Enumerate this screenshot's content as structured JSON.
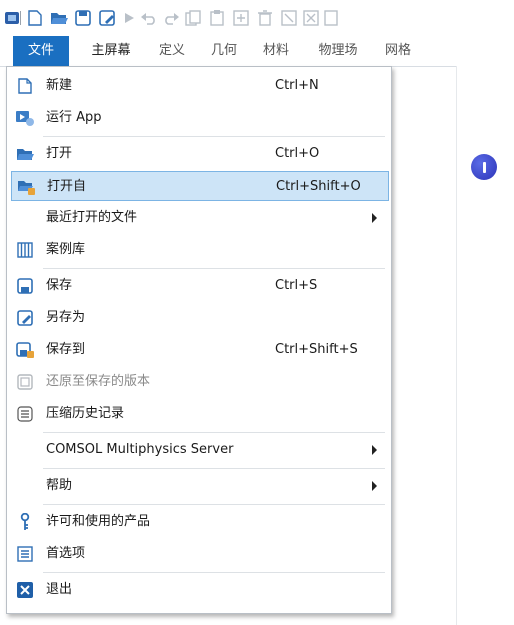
{
  "colors": {
    "accent": "#1a6fc1",
    "highlight_bg": "#cde4f7",
    "highlight_border": "#7cb4e4",
    "disabled_text": "#8a8a8a",
    "badge": "#3a44c8"
  },
  "quick_access": {
    "icons": [
      "app-icon",
      "new-icon",
      "open-icon",
      "save-icon",
      "save-as-icon",
      "run-icon",
      "undo-icon",
      "redo-icon",
      "copy-icon",
      "paste-icon",
      "duplicate-icon",
      "delete-icon",
      "clear-icon",
      "clear-all-icon",
      "more-icon"
    ]
  },
  "ribbon": {
    "tabs": [
      {
        "label": "文件"
      },
      {
        "label": "主屏幕"
      },
      {
        "label": "定义"
      },
      {
        "label": "几何"
      },
      {
        "label": "材料"
      },
      {
        "label": "物理场"
      },
      {
        "label": "网格"
      }
    ]
  },
  "menu": {
    "items": [
      {
        "label": "新建",
        "shortcut": "Ctrl+N",
        "icon": "new-file-icon"
      },
      {
        "label": "运行 App",
        "shortcut": "",
        "icon": "run-app-icon"
      },
      {
        "label": "打开",
        "shortcut": "Ctrl+O",
        "icon": "open-folder-icon"
      },
      {
        "label": "打开自",
        "shortcut": "Ctrl+Shift+O",
        "icon": "open-from-icon"
      },
      {
        "label": "最近打开的文件",
        "shortcut": "",
        "submenu": true
      },
      {
        "label": "案例库",
        "shortcut": "",
        "icon": "application-libraries-icon"
      },
      {
        "label": "保存",
        "shortcut": "Ctrl+S",
        "icon": "save-icon"
      },
      {
        "label": "另存为",
        "shortcut": "",
        "icon": "save-as-icon"
      },
      {
        "label": "保存到",
        "shortcut": "Ctrl+Shift+S",
        "icon": "save-to-icon"
      },
      {
        "label": "还原至保存的版本",
        "shortcut": "",
        "icon": "revert-icon",
        "disabled": true
      },
      {
        "label": "压缩历史记录",
        "shortcut": "",
        "icon": "compact-history-icon"
      },
      {
        "label": "COMSOL Multiphysics Server",
        "shortcut": "",
        "submenu": true
      },
      {
        "label": "帮助",
        "shortcut": "",
        "submenu": true
      },
      {
        "label": "许可和使用的产品",
        "shortcut": "",
        "icon": "license-key-icon"
      },
      {
        "label": "首选项",
        "shortcut": "",
        "icon": "preferences-icon"
      },
      {
        "label": "退出",
        "shortcut": "",
        "icon": "exit-icon"
      }
    ]
  }
}
